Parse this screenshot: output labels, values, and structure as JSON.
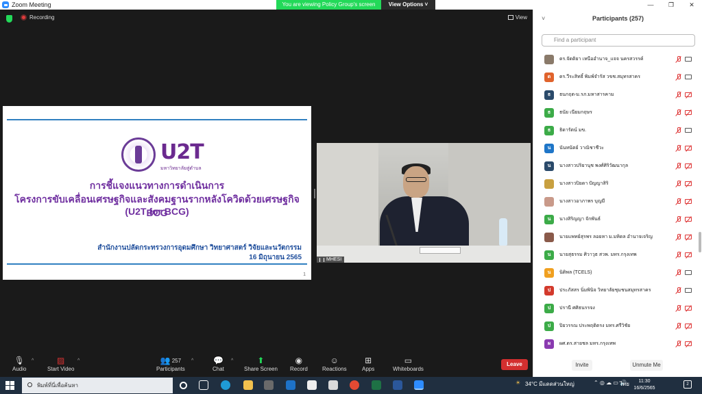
{
  "window": {
    "title": "Zoom Meeting",
    "controls": [
      "—",
      "❐",
      "✕"
    ]
  },
  "share_banner": {
    "text": "You are viewing Policy Group's screen",
    "view_options": "View Options ˅"
  },
  "meeting": {
    "recording_label": "Recording",
    "view_label": "View"
  },
  "slide": {
    "logo_text": "U2T",
    "logo_sub": "มหาวิทยาลัยสู่ตำบล",
    "title_line1": "การชี้แจงแนวทางการดำเนินการ",
    "title_line2": "โครงการขับเคลื่อนเศรษฐกิจและสังคมฐานรากหลังโควิดด้วยเศรษฐกิจ BCG",
    "title_line3": "(U2T for BCG)",
    "organization": "สำนักงานปลัดกระทรวงการอุดมศึกษา วิทยาศาสตร์ วิจัยและนวัตกรรม",
    "date": "16 มิถุนายน 2565",
    "page_number": "1"
  },
  "video": {
    "participant_label": "MHESI"
  },
  "toolbar": {
    "audio": "Audio",
    "start_video": "Start Video",
    "participants": "Participants",
    "participants_count": "257",
    "chat": "Chat",
    "share_screen": "Share Screen",
    "record": "Record",
    "reactions": "Reactions",
    "apps": "Apps",
    "whiteboards": "Whiteboards",
    "leave": "Leave",
    "audio_badge": "!"
  },
  "participants_panel": {
    "title": "Participants (257)",
    "search_placeholder": "Find a participant",
    "invite": "Invite",
    "unmute_me": "Unmute Me",
    "items": [
      {
        "name": "ดร.จัดติยา เหนืออำนาจ_แจจ นครสวรรค์",
        "initial": "",
        "color": "#8a7a6a",
        "cam_off": false
      },
      {
        "name": "ดร.วีระสิทธิ์ พิมพ์จำรัส วขช.สมุทรสาคร",
        "initial": "ด",
        "color": "#e0632c",
        "cam_off": false
      },
      {
        "name": "ธนกฤต-ม.รภ.มหาสารคาม",
        "initial": "ธ",
        "color": "#2a4a6a",
        "cam_off": true
      },
      {
        "name": "ธนัย เนียมกฤษร",
        "initial": "ธ",
        "color": "#3cab48",
        "cam_off": true
      },
      {
        "name": "ธิดารัตน์ มข.",
        "initial": "ธ",
        "color": "#3cab48",
        "cam_off": false
      },
      {
        "name": "นันทนัตย์ วาณิชาชีวะ",
        "initial": "น",
        "color": "#1f76c8",
        "cam_off": true
      },
      {
        "name": "นางสาวปริยานุช พงศ์ศิริวัฒนากุล",
        "initial": "น",
        "color": "#2a4a6a",
        "cam_off": true
      },
      {
        "name": "นางสาวปิยดา ปัญญาสิริ",
        "initial": "",
        "color": "#c8a040",
        "cam_off": true
      },
      {
        "name": "นางสาวอาภาพร บุญมี",
        "initial": "",
        "color": "#c99a8a",
        "cam_off": true
      },
      {
        "name": "นางสิริญญา จักพันธ์",
        "initial": "น",
        "color": "#3cab48",
        "cam_off": true
      },
      {
        "name": "นายแพทย์สุรพร ลอยหา ม.มหิดล อำนาจเจริญ",
        "initial": "",
        "color": "#8a5a4a",
        "cam_off": true
      },
      {
        "name": "นายสุธรรม ศิวาวุธ สวพ. มทร.กรุงเทพ",
        "initial": "น",
        "color": "#3cab48",
        "cam_off": true
      },
      {
        "name": "นิติพล (TCELS)",
        "initial": "น",
        "color": "#f0a020",
        "cam_off": false
      },
      {
        "name": "ประภัสสร นิ่มพินิจ วิทยาลัยชุมชนสมุทรสาคร",
        "initial": "ป",
        "color": "#d33a2c",
        "cam_off": false
      },
      {
        "name": "ปรานี ศศิธนรรจง",
        "initial": "ป",
        "color": "#3cab48",
        "cam_off": true
      },
      {
        "name": "ปิยวรรณ ประพฤติตรง มทร.ศรีวิชัย",
        "initial": "ป",
        "color": "#3cab48",
        "cam_off": true
      },
      {
        "name": "ผศ.ดร.สายชล มทร.กรุงเทพ",
        "initial": "ผ",
        "color": "#8a3ab0",
        "cam_off": true
      }
    ]
  },
  "taskbar": {
    "search_placeholder": "พิมพ์ที่นี่เพื่อค้นหา",
    "weather": "34°C มีแดดส่วนใหญ่",
    "language": "ไทย",
    "time": "11:30",
    "date": "16/6/2565",
    "notifications": "2"
  }
}
